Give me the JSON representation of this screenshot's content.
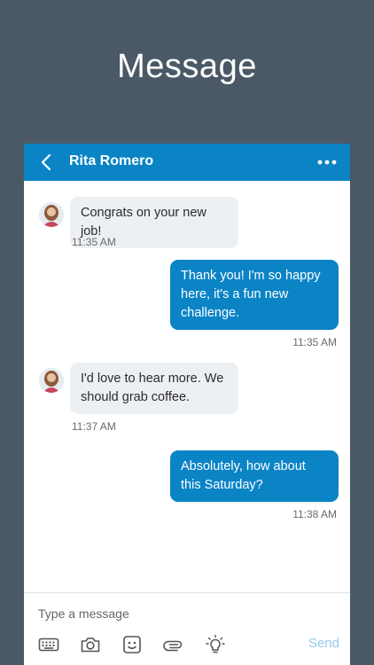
{
  "headline": "Message",
  "conversation": {
    "contact_name": "Rita Romero",
    "messages": [
      {
        "text": "Congrats on your new job!",
        "time": "11:35 AM"
      },
      {
        "text": "Thank you! I'm so happy here, it's a fun new challenge.",
        "time": "11:35 AM"
      },
      {
        "text": "I'd love to hear more. We should grab coffee.",
        "time": "11:37 AM"
      },
      {
        "text": "Absolutely, how about this Saturday?",
        "time": "11:38 AM"
      }
    ]
  },
  "composer": {
    "placeholder": "Type a message",
    "send_label": "Send",
    "tools": [
      "keyboard-icon",
      "camera-icon",
      "emoji-icon",
      "attachment-icon",
      "lightbulb-icon"
    ]
  },
  "colors": {
    "background": "#4a5965",
    "brand_blue": "#0b84c6",
    "incoming_bubble": "#edf0f3",
    "send_disabled": "#95c9ea"
  }
}
